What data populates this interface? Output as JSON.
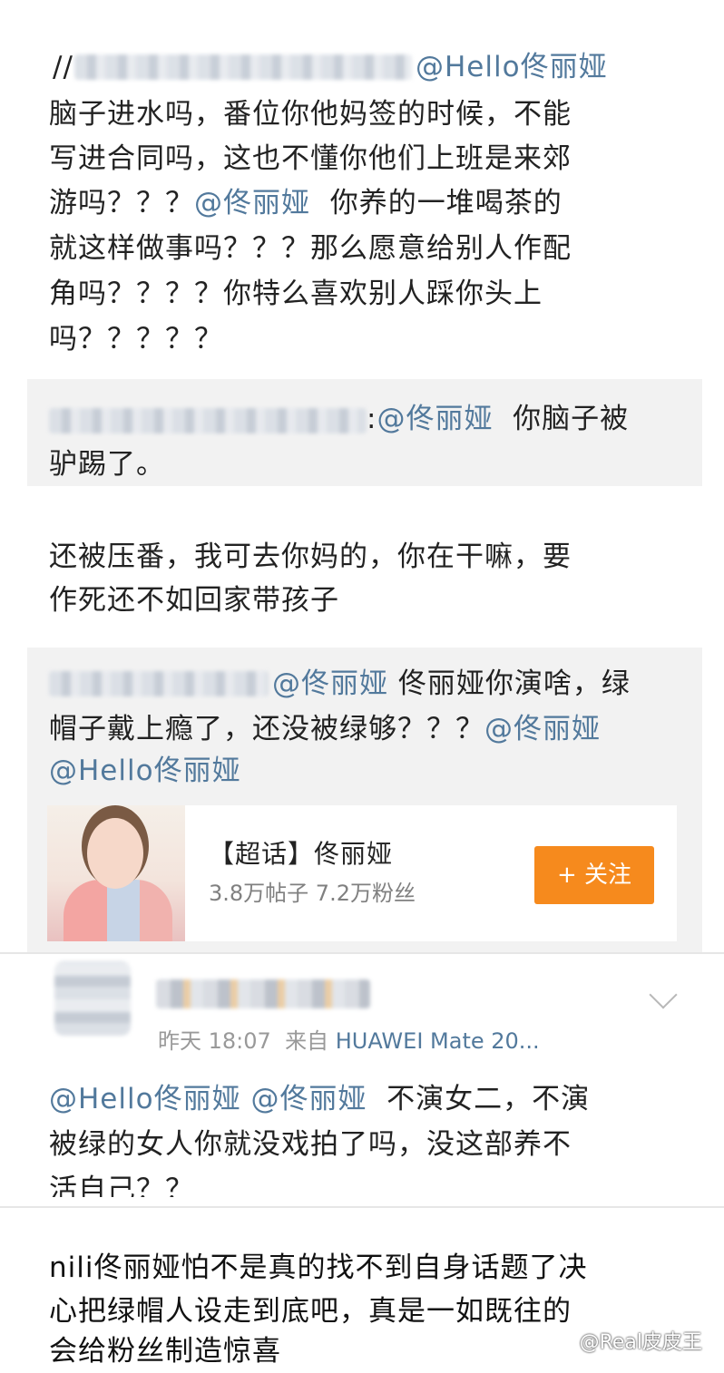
{
  "post1": {
    "prefix": "//",
    "mention": "@Hello佟丽娅",
    "lines": [
      "脑子进水吗，番位你他妈签的时候，不能",
      "写进合同吗，这也不懂你他们上班是来郊"
    ],
    "line3_a": "游吗？？？",
    "line3_mention": "@佟丽娅",
    "line3_b": "你养的一堆喝茶的",
    "line4": "就这样做事吗？？？那么愿意给别人作配",
    "line5": "角吗？？？？你特么喜欢别人踩你头上",
    "line6": "吗？？？？？"
  },
  "quote1": {
    "sep": ":",
    "mention": "@佟丽娅",
    "text": "你脑子被",
    "line2": "驴踢了。"
  },
  "post2": {
    "line1": "还被压番，我可去你妈的，你在干嘛，要",
    "line2": "作死还不如回家带孩子"
  },
  "quote2": {
    "mention1": "@佟丽娅",
    "text1": "佟丽娅你演啥，绿",
    "line2_text": "帽子戴上瘾了，还没被绿够？？？",
    "line2_mention": "@佟丽娅",
    "line3_mention": "@Hello佟丽娅"
  },
  "supertopic_card": {
    "title": "【超话】佟丽娅",
    "stats": "3.8万帖子  7.2万粉丝",
    "follow_label": "+ 关注"
  },
  "comment": {
    "time": "昨天 18:07",
    "source_prefix": "来自",
    "device": "HUAWEI Mate 20...",
    "mention1": "@Hello佟丽娅",
    "mention2": "@佟丽娅",
    "text1": "不演女二，不演",
    "line2": "被绿的女人你就没戏拍了吗，没这部养不",
    "line3": "活自己？？"
  },
  "caption": {
    "line1": "nili佟丽娅怕不是真的找不到自身话题了决",
    "line2": "心把绿帽人设走到底吧，真是一如既往的",
    "line3": "会给粉丝制造惊喜"
  },
  "watermark": "@Real皮皮王",
  "colors": {
    "mention": "#52799c",
    "follow_button": "#f68a1d",
    "quote_bg": "#f2f2f2"
  }
}
